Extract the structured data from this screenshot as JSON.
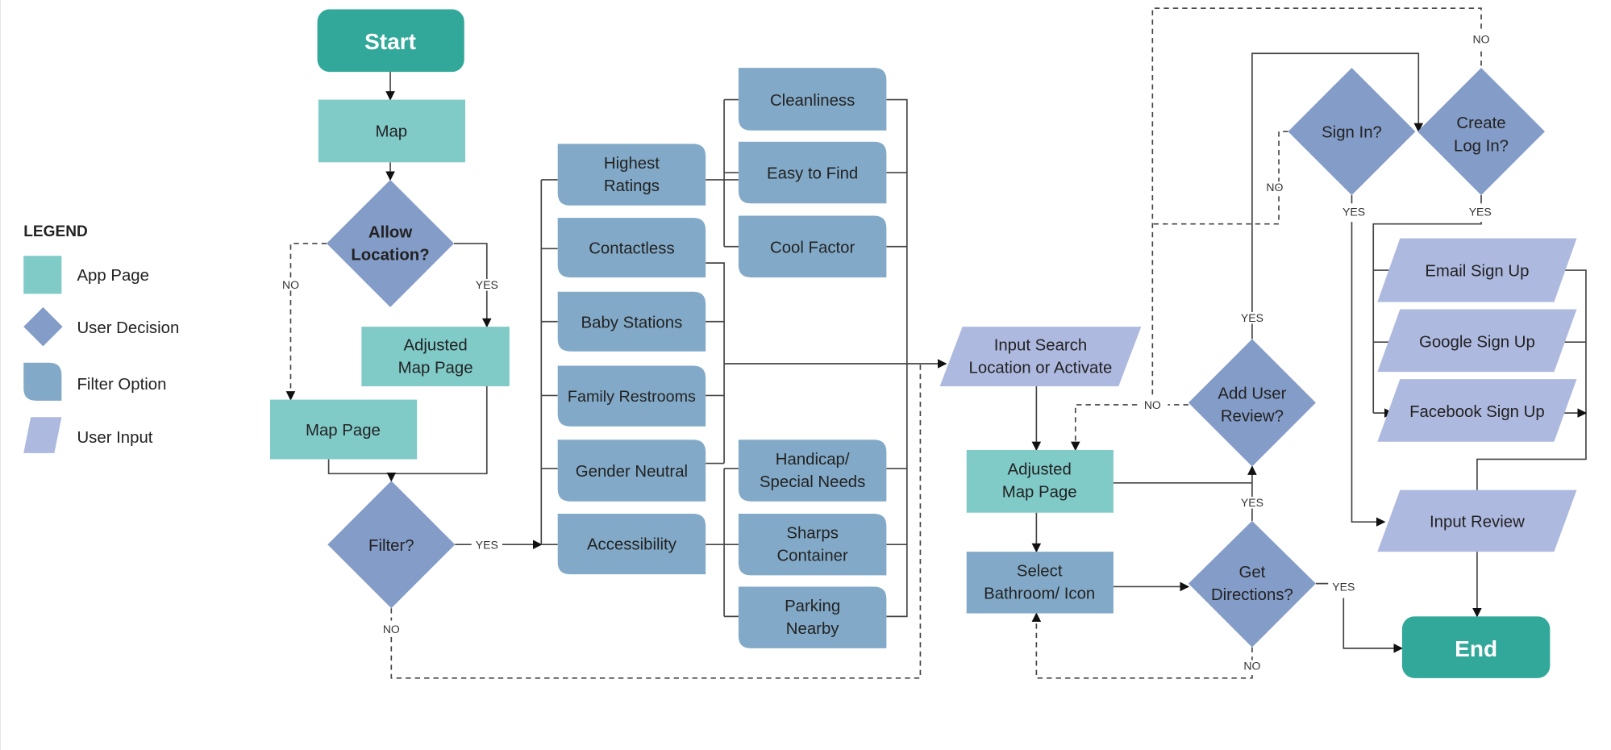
{
  "colors": {
    "terminal": "#31a899",
    "app_page": "#80cbc8",
    "user_decision": "#849cc8",
    "filter_option": "#82aac8",
    "user_input": "#aeb9e0"
  },
  "legend": {
    "title": "LEGEND",
    "items": [
      {
        "label": "App Page",
        "shape": "square"
      },
      {
        "label": "User Decision",
        "shape": "diamond"
      },
      {
        "label": "Filter Option",
        "shape": "rounded-tab"
      },
      {
        "label": "User Input",
        "shape": "parallelogram"
      }
    ]
  },
  "nodes": {
    "start": "Start",
    "map": "Map",
    "allow_location": [
      "Allow",
      "Location?"
    ],
    "adjusted_map_1": [
      "Adjusted",
      "Map Page"
    ],
    "map_page": "Map Page",
    "filter": "Filter?",
    "highest_ratings": [
      "Highest",
      "Ratings"
    ],
    "contactless": "Contactless",
    "baby_stations": "Baby Stations",
    "family_restrooms": "Family Restrooms",
    "gender_neutral": "Gender Neutral",
    "accessibility": "Accessibility",
    "cleanliness": "Cleanliness",
    "easy_to_find": "Easy to Find",
    "cool_factor": "Cool Factor",
    "handicap": [
      "Handicap/",
      "Special Needs"
    ],
    "sharps": [
      "Sharps",
      "Container"
    ],
    "parking": [
      "Parking",
      "Nearby"
    ],
    "input_search": [
      "Input Search",
      "Location or Activate"
    ],
    "adjusted_map_2": [
      "Adjusted",
      "Map Page"
    ],
    "select_bathroom": [
      "Select",
      "Bathroom/ Icon"
    ],
    "add_user_review": [
      "Add User",
      "Review?"
    ],
    "get_directions": [
      "Get",
      "Directions?"
    ],
    "sign_in": "Sign In?",
    "create_login": [
      "Create",
      "Log In?"
    ],
    "email_signup": "Email Sign Up",
    "google_signup": "Google Sign Up",
    "facebook_signup": "Facebook Sign Up",
    "input_review": "Input Review",
    "end": "End"
  },
  "edge_labels": {
    "yes": "YES",
    "no": "NO"
  }
}
